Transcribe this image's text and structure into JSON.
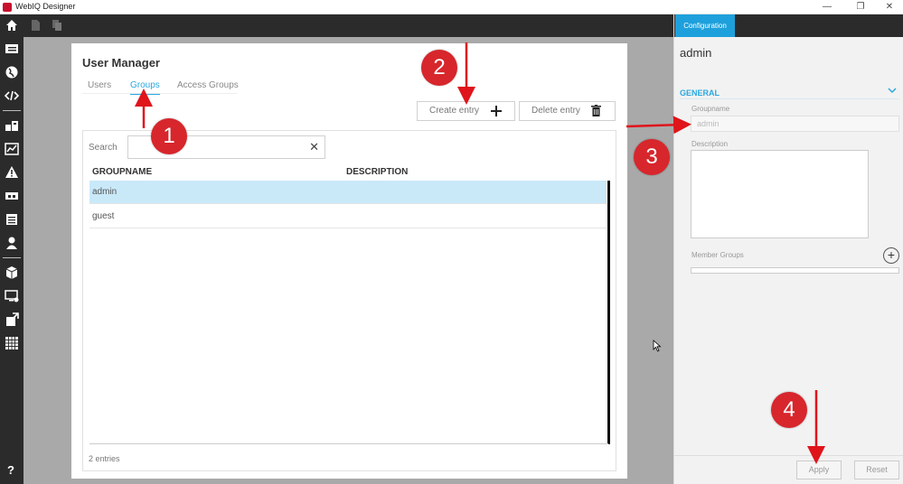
{
  "window": {
    "title": "WebIQ Designer",
    "controls": [
      "—",
      "❐",
      "✕"
    ]
  },
  "colors": {
    "accent": "#29a8e0",
    "selected_row": "#c9e9f9",
    "badge": "#d7262c",
    "dark": "#2b2b2b"
  },
  "user_manager": {
    "title": "User Manager",
    "tabs": [
      {
        "label": "Users",
        "active": false
      },
      {
        "label": "Groups",
        "active": true
      },
      {
        "label": "Access Groups",
        "active": false
      }
    ],
    "create_label": "Create entry",
    "delete_label": "Delete entry",
    "search_label": "Search",
    "search_value": "",
    "columns": [
      "GROUPNAME",
      "DESCRIPTION"
    ],
    "rows": [
      {
        "name": "admin",
        "description": "",
        "selected": true
      },
      {
        "name": "guest",
        "description": "",
        "selected": false
      }
    ],
    "entries_count": "2 entries"
  },
  "config": {
    "tab_label": "Configuration",
    "title": "admin",
    "section": "GENERAL",
    "groupname_label": "Groupname",
    "groupname_value": "admin",
    "description_label": "Description",
    "member_groups_label": "Member Groups",
    "apply_label": "Apply",
    "reset_label": "Reset"
  },
  "annotations": [
    "1",
    "2",
    "3",
    "4"
  ],
  "icons": {
    "sidebar": [
      "list-icon",
      "globe-icon",
      "code-icon",
      "widgets-icon",
      "chart-icon",
      "warning-icon",
      "panel-icon",
      "document-icon",
      "user-icon",
      "cube-icon",
      "monitor-gear-icon",
      "export-icon",
      "grid-icon",
      "help-icon"
    ],
    "toolbar": [
      "home-icon",
      "file-icon",
      "copy-icon"
    ]
  },
  "help_label": "?"
}
